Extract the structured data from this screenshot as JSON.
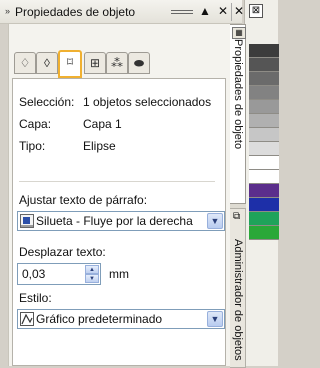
{
  "title_bar": {
    "title": "Propiedades de objeto",
    "grip": "»",
    "up_icon": "▲",
    "close_icon": "✕"
  },
  "outer_close": "✕",
  "icon_tabs": [
    {
      "icon": "fill-bucket-icon",
      "glyph": "♢"
    },
    {
      "icon": "pen-outline-icon",
      "glyph": "◊"
    },
    {
      "icon": "frame-icon",
      "glyph": "⌑"
    },
    {
      "icon": "grid-frame-icon",
      "glyph": "⊞"
    },
    {
      "icon": "pattern-icon",
      "glyph": "⁂"
    },
    {
      "icon": "ellipse-icon",
      "glyph": "⬬"
    }
  ],
  "info": {
    "seleccion_label": "Selección:",
    "seleccion_value": "1 objetos seleccionados",
    "capa_label": "Capa:",
    "capa_value": "Capa 1",
    "tipo_label": "Tipo:",
    "tipo_value": "Elipse"
  },
  "wrap": {
    "label": "Ajustar texto de párrafo:",
    "value": "Silueta - Fluye por la derecha"
  },
  "offset": {
    "label": "Desplazar texto:",
    "value": "0,03",
    "unit": "mm"
  },
  "style": {
    "label": "Estilo:",
    "value": "Gráfico predeterminado"
  },
  "vertical_tabs": [
    {
      "label": "Propiedades de objeto"
    },
    {
      "label": "Administrador de objetos"
    }
  ],
  "swatch_colors": [
    "#3c3c3c",
    "#555555",
    "#6b6b6b",
    "#828282",
    "#999999",
    "#b0b0b0",
    "#c6c6c6",
    "#dcdcdc",
    "#ffffff",
    "#ffffff",
    "#5b2e8c",
    "#1d2fa8",
    "#1fa35a",
    "#2aa838"
  ]
}
